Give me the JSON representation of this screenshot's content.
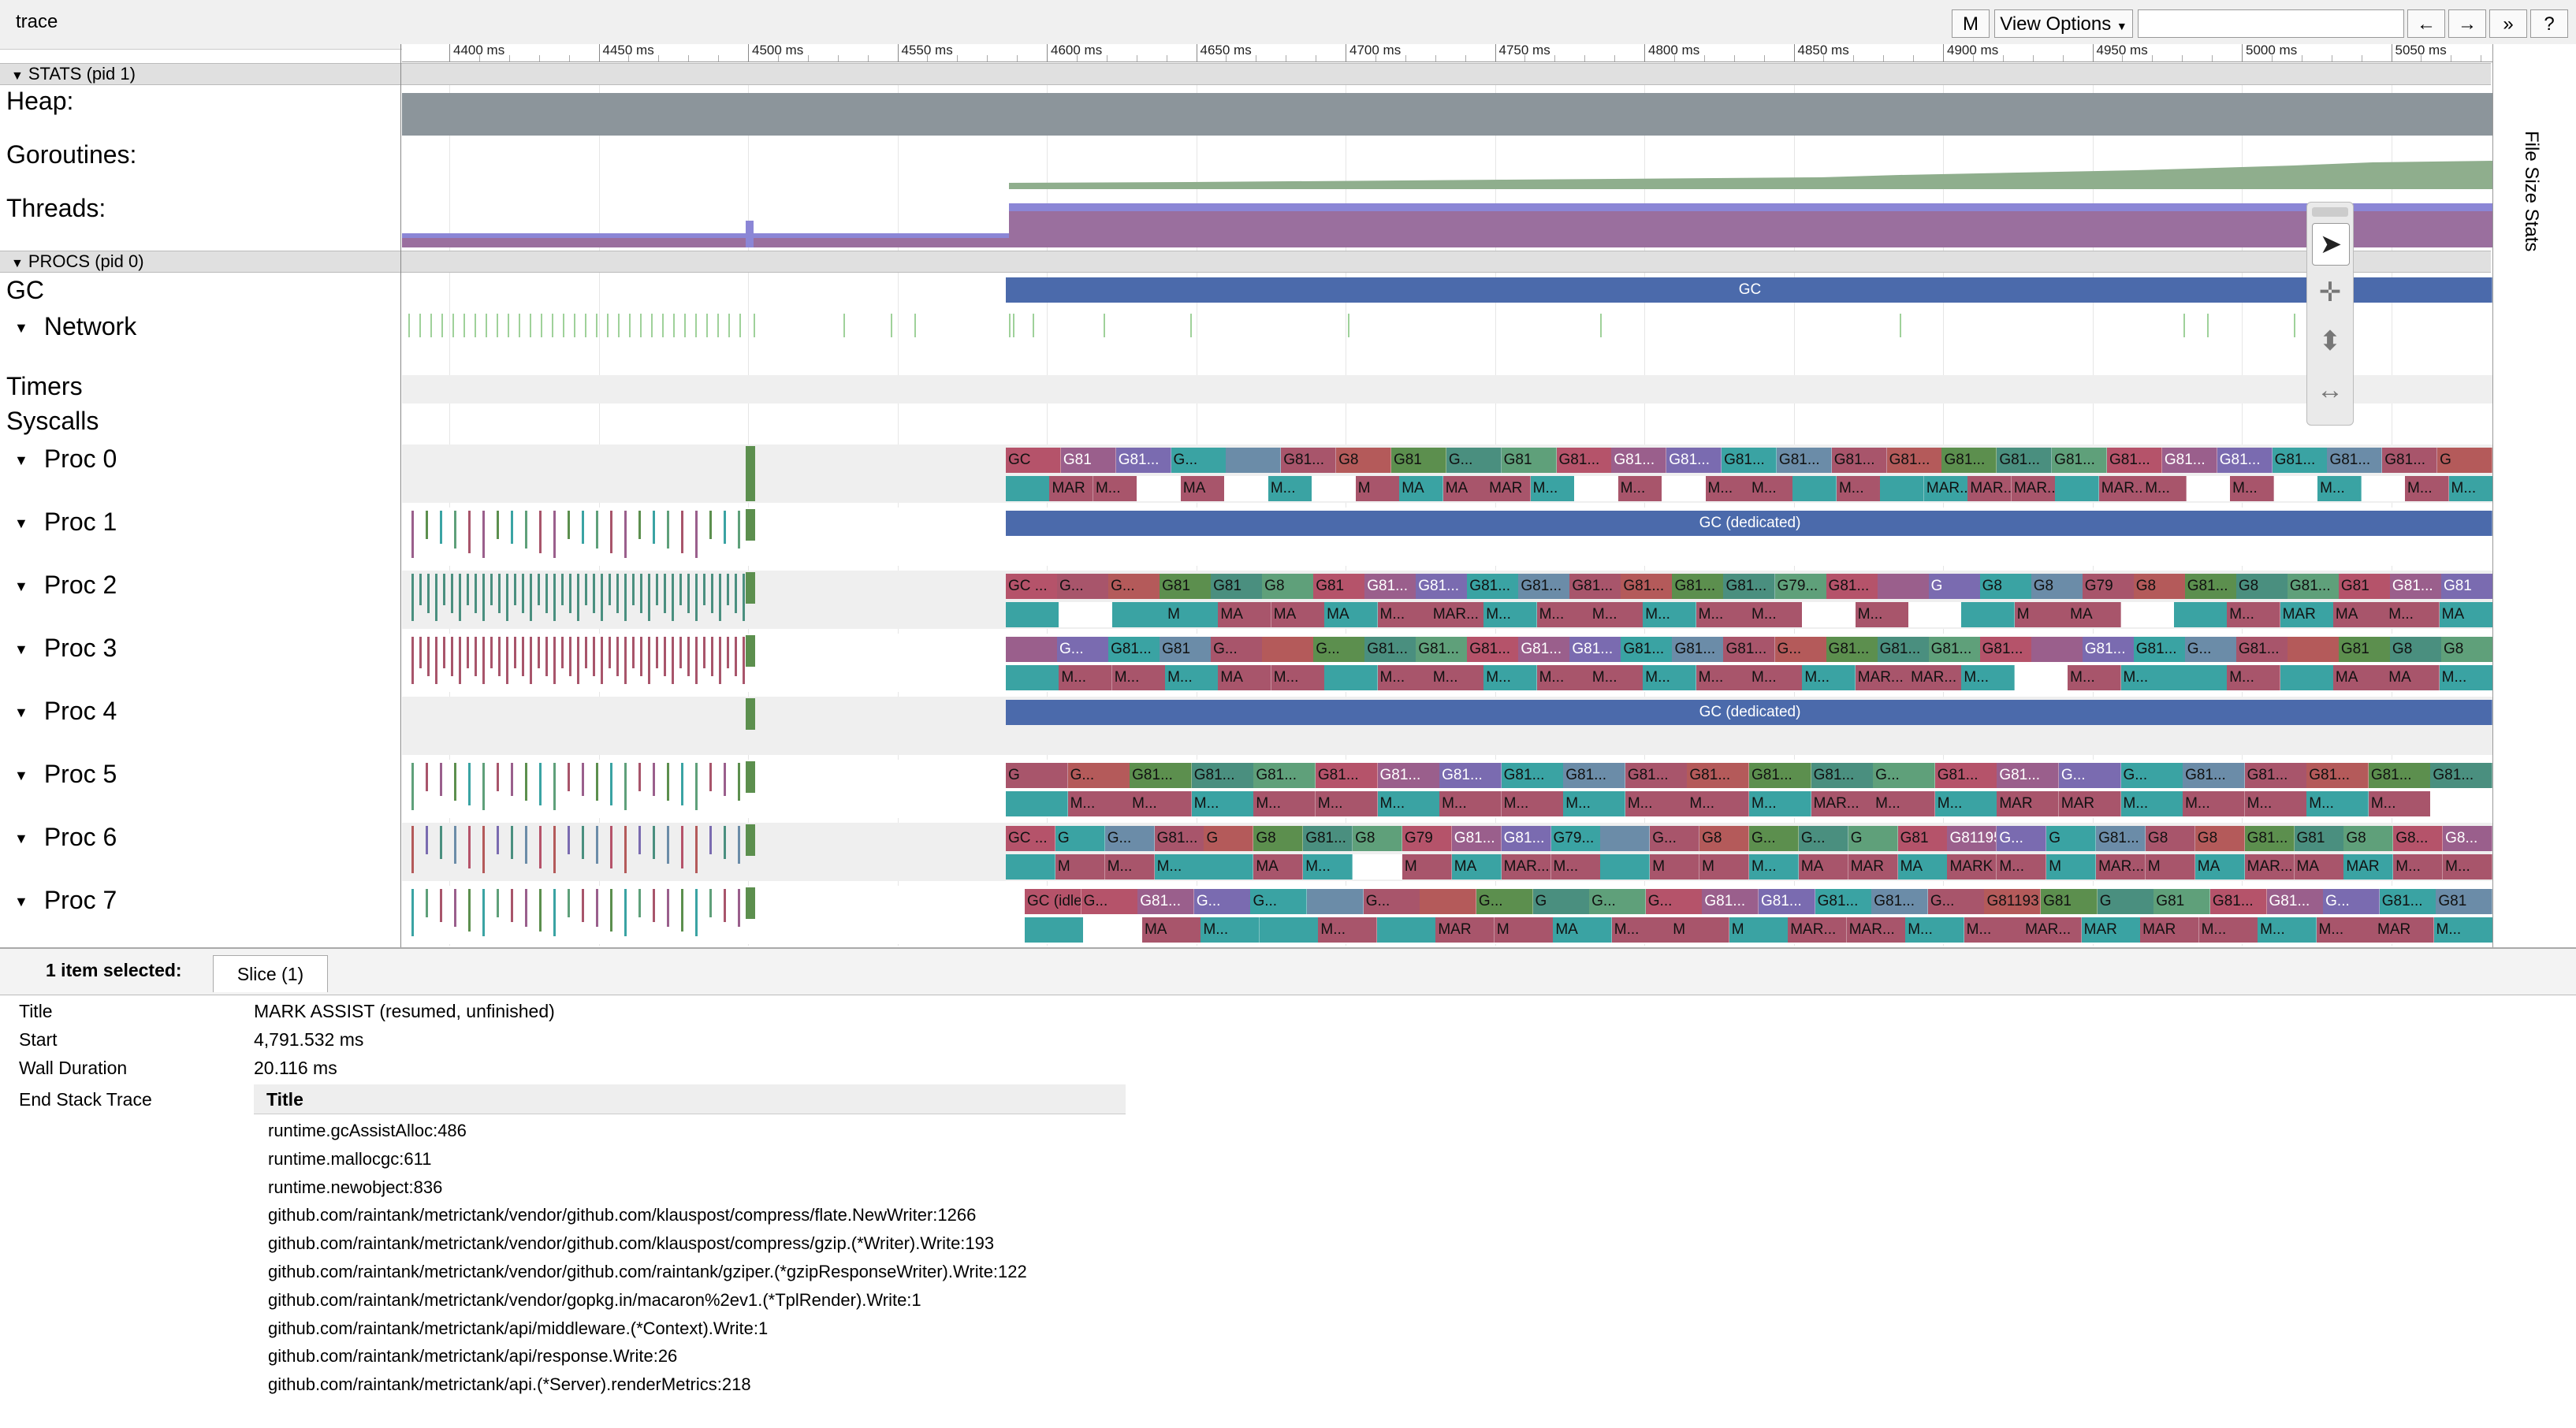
{
  "app": {
    "title": "trace"
  },
  "toolbar": {
    "m_btn": "M",
    "view_options": "View Options",
    "prev": "←",
    "next": "→",
    "more": "»",
    "help": "?"
  },
  "ruler": {
    "ticks": [
      "4400 ms",
      "4450 ms",
      "4500 ms",
      "4550 ms",
      "4600 ms",
      "4650 ms",
      "4700 ms",
      "4750 ms",
      "4800 ms",
      "4850 ms",
      "4900 ms",
      "4950 ms",
      "5000 ms",
      "5050 ms"
    ]
  },
  "sections": {
    "stats": "STATS (pid 1)",
    "procs": "PROCS (pid 0)"
  },
  "tracks": {
    "heap": "Heap:",
    "goroutines": "Goroutines:",
    "threads": "Threads:",
    "gc": "GC",
    "network": "Network",
    "timers": "Timers",
    "syscalls": "Syscalls",
    "procs": [
      "Proc 0",
      "Proc 1",
      "Proc 2",
      "Proc 3",
      "Proc 4",
      "Proc 5",
      "Proc 6",
      "Proc 7"
    ]
  },
  "slices": {
    "gc": "GC",
    "gc_dedicated": "GC (dedicated)",
    "gc_idle": "GC (idle)"
  },
  "side": {
    "file_size_stats": "File Size Stats"
  },
  "selection": {
    "count": "1 item selected:",
    "tab": "Slice (1)",
    "props": [
      {
        "k": "Title",
        "v": "MARK ASSIST (resumed, unfinished)"
      },
      {
        "k": "Start",
        "v": "4,791.532 ms"
      },
      {
        "k": "Wall Duration",
        "v": "20.116 ms"
      },
      {
        "k": "End Stack Trace",
        "v": ""
      }
    ],
    "stack_header": "Title",
    "frames": [
      "runtime.gcAssistAlloc:486",
      "runtime.mallocgc:611",
      "runtime.newobject:836",
      "github.com/raintank/metrictank/vendor/github.com/klauspost/compress/flate.NewWriter:1266",
      "github.com/raintank/metrictank/vendor/github.com/klauspost/compress/gzip.(*Writer).Write:193",
      "github.com/raintank/metrictank/vendor/github.com/raintank/gziper.(*gzipResponseWriter).Write:122",
      "github.com/raintank/metrictank/vendor/gopkg.in/macaron%2ev1.(*TplRender).Write:1",
      "github.com/raintank/metrictank/api/middleware.(*Context).Write:1",
      "github.com/raintank/metrictank/api/response.Write:26",
      "github.com/raintank/metrictank/api.(*Server).renderMetrics:218"
    ]
  },
  "proc_rows": [
    {
      "top": [
        "GC",
        "G81",
        "G81...",
        "G...",
        "",
        "G81...",
        "G8",
        "G81",
        "G...",
        "G81",
        "G81...",
        "G81...",
        "G81...",
        "G81...",
        "G81...",
        "G81...",
        "G81...",
        "G81...",
        "G81...",
        "G81...",
        "G81...",
        "G81...",
        "G81...",
        "G81...",
        "G81...",
        "G81...",
        "G"
      ],
      "bottom": [
        "",
        "MAR",
        "M...",
        "",
        "MA",
        "",
        "M...",
        "",
        "M",
        "MA",
        "MA",
        "MAR",
        "M...",
        "",
        "M...",
        "",
        "M...",
        "M...",
        "",
        "M...",
        "",
        "MAR...",
        "MAR...",
        "MAR...",
        "",
        "MAR...",
        "M...",
        "",
        "M...",
        "",
        "M...",
        "",
        "M...",
        "M..."
      ]
    },
    {
      "top": [],
      "bottom": []
    },
    {
      "top": [
        "GC ...",
        "G...",
        "G...",
        "G81",
        "G81",
        "G8",
        "G81",
        "G81...",
        "G81...",
        "G81...",
        "G81...",
        "G81...",
        "G81...",
        "G81...",
        "G81...",
        "G79...",
        "G81...",
        "",
        "G",
        "G8",
        "G8",
        "G79",
        "G8",
        "G81...",
        "G8",
        "G81...",
        "G81",
        "G81...",
        "G81"
      ],
      "bottom": [
        "",
        "",
        "",
        "M",
        "MA",
        "MA",
        "MA",
        "M...",
        "MAR...",
        "M...",
        "M...",
        "M...",
        "M...",
        "M...",
        "M...",
        "",
        "M...",
        "",
        "",
        "M",
        "MA",
        "",
        "",
        "M...",
        "MAR",
        "MA",
        "M...",
        "MA"
      ]
    },
    {
      "top": [
        "",
        "G...",
        "G81...",
        "G81",
        "G...",
        "",
        "G...",
        "G81...",
        "G81...",
        "G81...",
        "G81...",
        "G81...",
        "G81...",
        "G81...",
        "G81...",
        "G...",
        "G81...",
        "G81...",
        "G81...",
        "G81...",
        "",
        "G81...",
        "G81...",
        "G...",
        "G81...",
        "",
        "G81",
        "G8",
        "G8"
      ],
      "bottom": [
        "",
        "M...",
        "M...",
        "M...",
        "MA",
        "M...",
        "",
        "M...",
        "M...",
        "M...",
        "M...",
        "M...",
        "M...",
        "M...",
        "M...",
        "M...",
        "MAR...",
        "MAR...",
        "M...",
        "",
        "M...",
        "M...",
        "",
        "M...",
        "",
        "MA",
        "MA",
        "M..."
      ]
    },
    {
      "top": [],
      "bottom": []
    },
    {
      "top": [
        "G",
        "G...",
        "G81...",
        "G81...",
        "G81...",
        "G81...",
        "G81...",
        "G81...",
        "G81...",
        "G81...",
        "G81...",
        "G81...",
        "G81...",
        "G81...",
        "G...",
        "G81...",
        "G81...",
        "G...",
        "G...",
        "G81...",
        "G81...",
        "G81...",
        "G81...",
        "G81..."
      ],
      "bottom": [
        "",
        "M...",
        "M...",
        "M...",
        "M...",
        "M...",
        "M...",
        "M...",
        "M...",
        "M...",
        "M...",
        "M...",
        "M...",
        "MAR...",
        "M...",
        "M...",
        "MAR",
        "MAR",
        "M...",
        "M...",
        "M...",
        "M...",
        "M...",
        ""
      ]
    },
    {
      "top": [
        "GC ...",
        "G",
        "G...",
        "G81...",
        "G",
        "G8",
        "G81...",
        "G8",
        "G79",
        "G81...",
        "G81...",
        "G79...",
        "",
        "G...",
        "G8",
        "G...",
        "G...",
        "G",
        "G81",
        "G8119584 ...",
        "G...",
        "G",
        "G81...",
        "G8",
        "G8",
        "G81...",
        "G81",
        "G8",
        "G8...",
        "G8..."
      ],
      "bottom": [
        "",
        "M",
        "M...",
        "M...",
        "",
        "MA",
        "M...",
        "",
        "M",
        "MA",
        "MAR...",
        "M...",
        "",
        "M",
        "M",
        "M...",
        "MA",
        "MAR",
        "MA",
        "MARK A...",
        "M...",
        "M",
        "MAR...",
        "M",
        "MA",
        "MAR...",
        "MA",
        "MAR",
        "M...",
        "M..."
      ]
    },
    {
      "top": [
        "GC (idle)",
        "G...",
        "G81...",
        "G...",
        "G...",
        "",
        "G...",
        "",
        "G...",
        "G",
        "G...",
        "G...",
        "G81...",
        "G81...",
        "G81...",
        "G81...",
        "G...",
        "G81193...",
        "G81",
        "G",
        "G81",
        "G81...",
        "G81...",
        "G...",
        "G81...",
        "G81"
      ],
      "bottom": [
        "",
        "",
        "MA",
        "M...",
        "",
        "M...",
        "",
        "MAR",
        "M",
        "MA",
        "M...",
        "M",
        "M",
        "MAR...",
        "MAR...",
        "M...",
        "M...",
        "MAR...",
        "MAR",
        "MAR",
        "M...",
        "M...",
        "M...",
        "MAR",
        "M..."
      ]
    }
  ],
  "colors": {
    "heap": "#8c959b",
    "goroutines": "#8fae8d",
    "threads_a": "#9a6f9e",
    "threads_b": "#8b86d6",
    "gc": "#4b6aab",
    "palette": [
      "#b5536a",
      "#5c8f4e",
      "#6b8ca8",
      "#9a5f8c",
      "#4a8f7f",
      "#a8556b",
      "#7a6bb0",
      "#5fa07a",
      "#b45a5a",
      "#3aa3a3"
    ]
  }
}
